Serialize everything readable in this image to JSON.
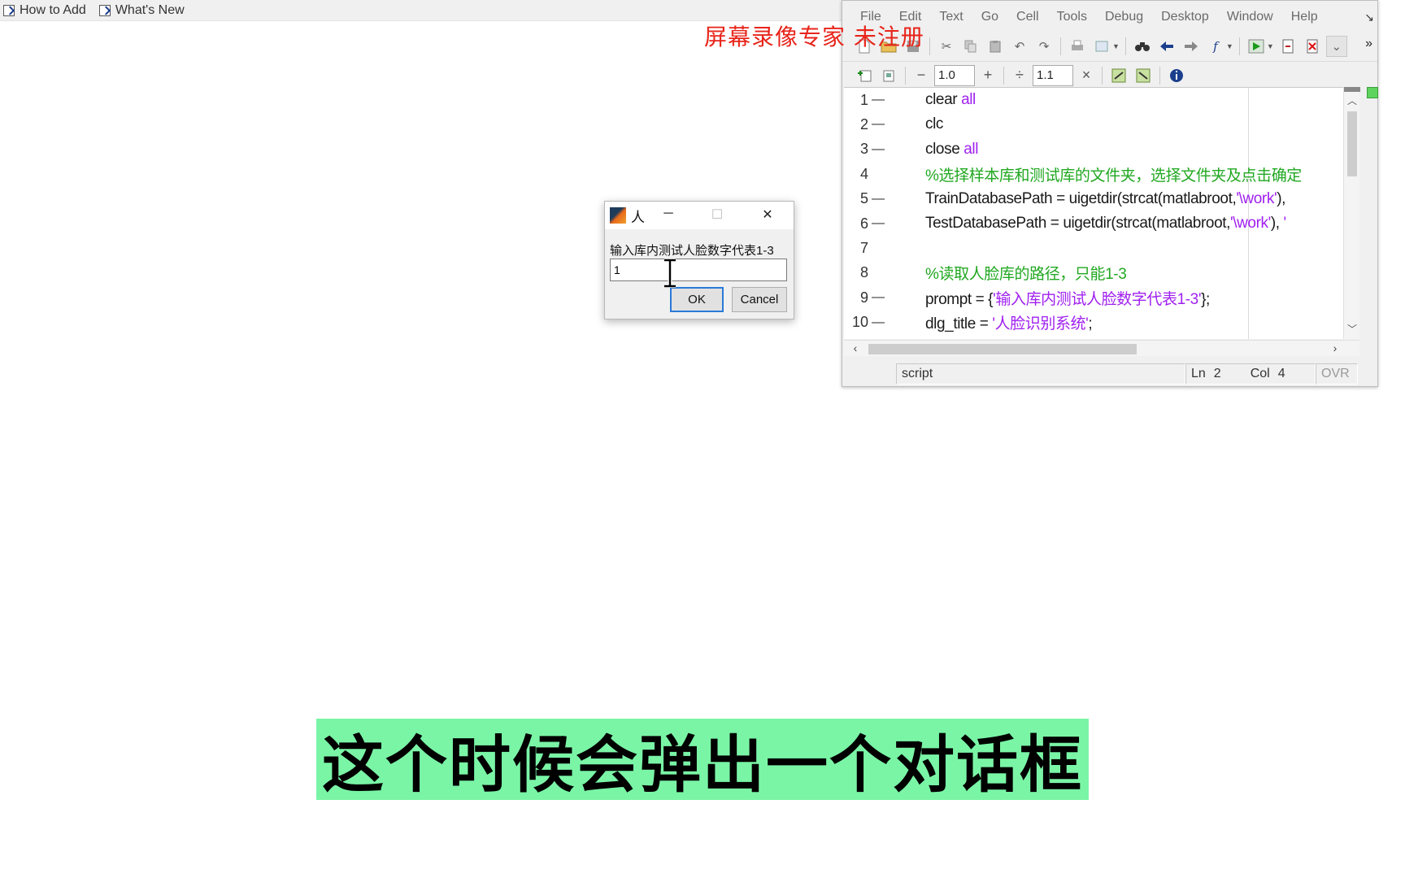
{
  "shortcuts": {
    "items": [
      "How to Add",
      "What's New"
    ]
  },
  "watermark": "屏幕录像专家 未注册",
  "editor": {
    "menu": [
      "File",
      "Edit",
      "Text",
      "Go",
      "Cell",
      "Tools",
      "Debug",
      "Desktop",
      "Window",
      "Help"
    ],
    "cell_toolbar": {
      "decrement": "−",
      "value1": "1.0",
      "increment": "+",
      "divide": "÷",
      "value2": "1.1",
      "multiply": "×"
    },
    "lines": [
      {
        "num": "1",
        "dash": "—",
        "parts": [
          [
            "c",
            "clear "
          ],
          [
            "k",
            "all"
          ]
        ]
      },
      {
        "num": "2",
        "dash": "—",
        "parts": [
          [
            "c",
            "clc"
          ]
        ]
      },
      {
        "num": "3",
        "dash": "—",
        "parts": [
          [
            "c",
            "close "
          ],
          [
            "k",
            "all"
          ]
        ]
      },
      {
        "num": "4",
        "dash": "",
        "parts": [
          [
            "m",
            "%选择样本库和测试库的文件夹，选择文件夹及点击确定"
          ]
        ]
      },
      {
        "num": "5",
        "dash": "—",
        "parts": [
          [
            "c",
            "TrainDatabasePath = uigetdir(strcat(matlabroot,"
          ],
          [
            "s",
            "'\\work'"
          ],
          [
            "c",
            "), "
          ]
        ]
      },
      {
        "num": "6",
        "dash": "—",
        "parts": [
          [
            "c",
            "TestDatabasePath = uigetdir(strcat(matlabroot,"
          ],
          [
            "s",
            "'\\work'"
          ],
          [
            "c",
            "), "
          ],
          [
            "s",
            "'"
          ]
        ]
      },
      {
        "num": "7",
        "dash": "",
        "parts": []
      },
      {
        "num": "8",
        "dash": "",
        "parts": [
          [
            "m",
            "%读取人脸库的路径，只能1-3"
          ]
        ]
      },
      {
        "num": "9",
        "dash": "—",
        "parts": [
          [
            "c",
            "prompt = {"
          ],
          [
            "s",
            "'输入库内测试人脸数字代表1-3'"
          ],
          [
            "c",
            "};"
          ]
        ]
      },
      {
        "num": "10",
        "dash": "—",
        "parts": [
          [
            "c",
            "dlg_title = "
          ],
          [
            "s",
            "'人脸识别系统'"
          ],
          [
            "c",
            ";"
          ]
        ]
      }
    ],
    "status": {
      "mode": "script",
      "ln_label": "Ln",
      "ln": "2",
      "col_label": "Col",
      "col": "4",
      "ovr": "OVR"
    }
  },
  "dialog": {
    "title": "人",
    "minimize": "─",
    "maximize": "☐",
    "close": "✕",
    "prompt": "输入库内测试人脸数字代表1-3",
    "input_value": "1",
    "ok_label": "OK",
    "cancel_label": "Cancel"
  },
  "subtitle": "这个时候会弹出一个对话框",
  "colors": {
    "subtitle_bg": "#7af5a6",
    "keyword": "#a020f0",
    "comment": "#21a821",
    "watermark": "#e8241a",
    "ok_focus": "#2a7ad6"
  }
}
